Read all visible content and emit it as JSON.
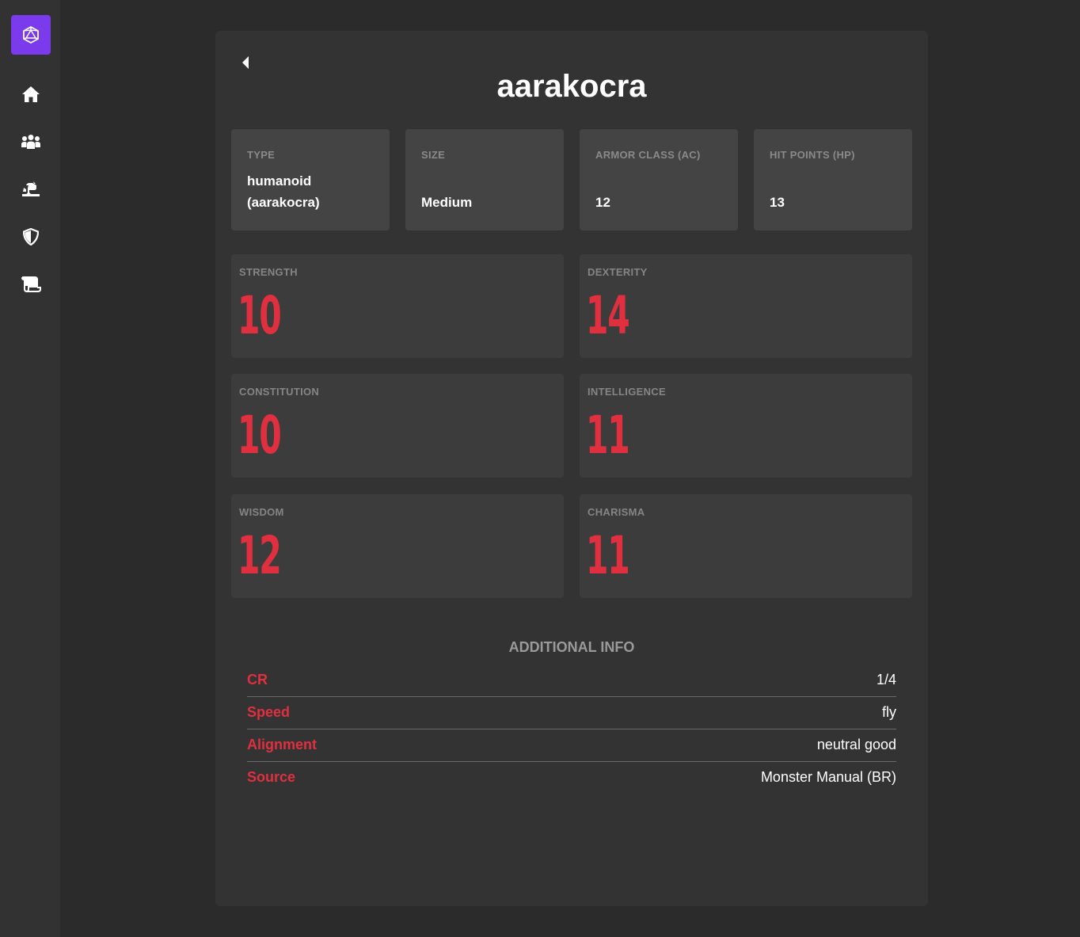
{
  "sidebar": {
    "logo_icon": "d20-icon",
    "accent": "#7c3aed",
    "items": [
      {
        "icon": "home-icon"
      },
      {
        "icon": "users-icon"
      },
      {
        "icon": "dragon-icon"
      },
      {
        "icon": "shield-icon"
      },
      {
        "icon": "scroll-icon"
      }
    ]
  },
  "monster": {
    "name": "aarakocra",
    "info": [
      {
        "label": "TYPE",
        "value": "humanoid (aarakocra)"
      },
      {
        "label": "SIZE",
        "value": "Medium"
      },
      {
        "label": "ARMOR CLASS (AC)",
        "value": "12"
      },
      {
        "label": "HIT POINTS (HP)",
        "value": "13"
      }
    ],
    "stats": [
      {
        "label": "STRENGTH",
        "value": "10"
      },
      {
        "label": "DEXTERITY",
        "value": "14"
      },
      {
        "label": "CONSTITUTION",
        "value": "10"
      },
      {
        "label": "INTELLIGENCE",
        "value": "11"
      },
      {
        "label": "WISDOM",
        "value": "12"
      },
      {
        "label": "CHARISMA",
        "value": "11"
      }
    ],
    "additional_title": "ADDITIONAL INFO",
    "additional": [
      {
        "key": "CR",
        "value": "1/4"
      },
      {
        "key": "Speed",
        "value": "fly"
      },
      {
        "key": "Alignment",
        "value": "neutral good"
      },
      {
        "key": "Source",
        "value": "Monster Manual (BR)"
      }
    ]
  },
  "colors": {
    "accent_red": "#e0303f",
    "card_bg": "#333333"
  }
}
